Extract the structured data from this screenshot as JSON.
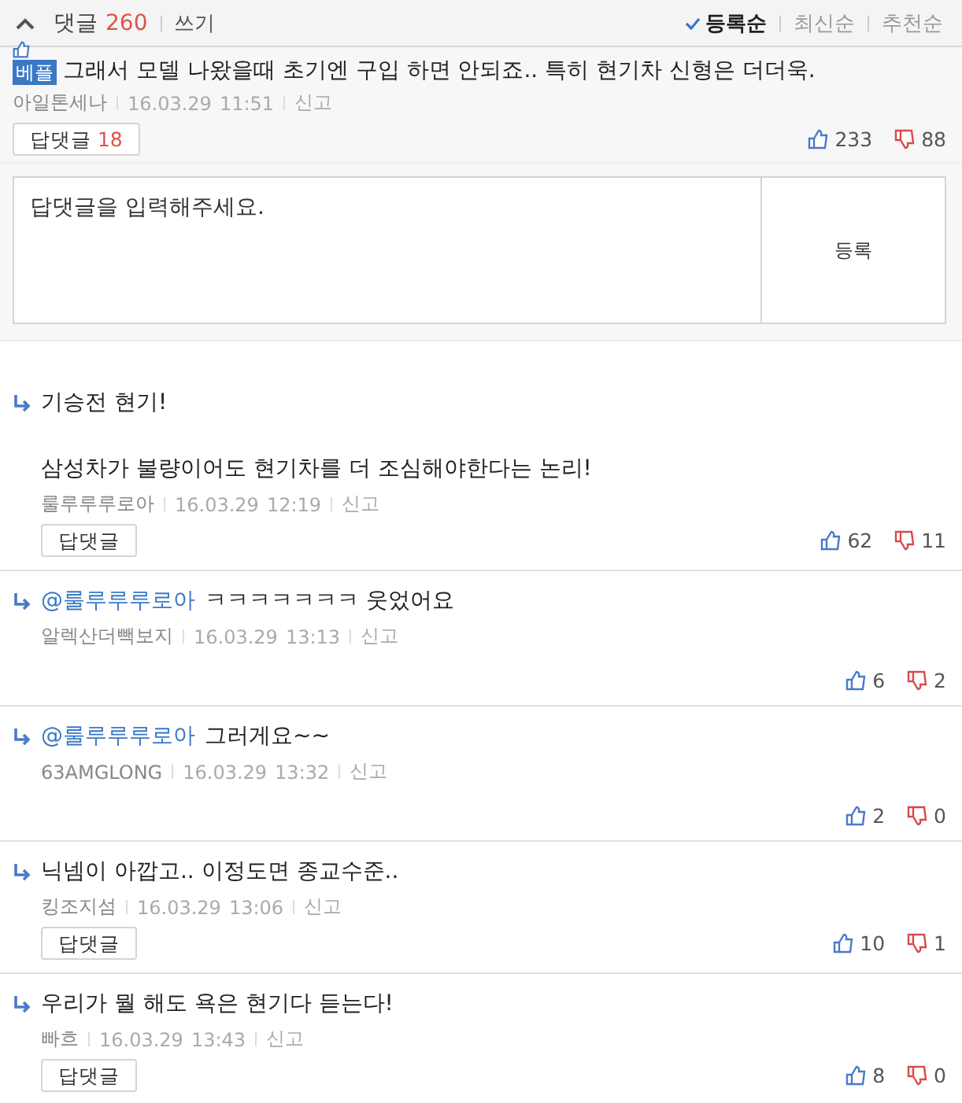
{
  "header": {
    "expanded": true,
    "title": "댓글",
    "count": "260",
    "write_link": "쓰기",
    "sort_options": [
      {
        "label": "등록순",
        "selected": true
      },
      {
        "label": "최신순",
        "selected": false
      },
      {
        "label": "추천순",
        "selected": false
      }
    ]
  },
  "best_comment": {
    "badge": "베플",
    "text": "그래서 모델 나왔을때 초기엔 구입 하면 안되죠.. 특히 현기차 신형은 더더욱.",
    "author": "아일톤세나",
    "date": "16.03.29",
    "time": "11:51",
    "report": "신고",
    "reply_button": {
      "label": "답댓글",
      "count": "18"
    },
    "likes": "233",
    "dislikes": "88"
  },
  "reply_form": {
    "placeholder": "답댓글을 입력해주세요.",
    "submit": "등록"
  },
  "replies": [
    {
      "lines": [
        "기승전 현기!",
        "삼성차가 불량이어도 현기차를 더 조심해야한다는 논리!"
      ],
      "author": "룰루루루로아",
      "date": "16.03.29",
      "time": "12:19",
      "report": "신고",
      "reply_button": "답댓글",
      "likes": "62",
      "dislikes": "11"
    },
    {
      "mention": "@룰루루루로아",
      "lines": [
        "ㅋㅋㅋㅋㅋㅋㅋ 웃었어요"
      ],
      "author": "알렉산더빽보지",
      "date": "16.03.29",
      "time": "13:13",
      "report": "신고",
      "likes": "6",
      "dislikes": "2"
    },
    {
      "mention": "@룰루루루로아",
      "lines": [
        "그러게요~~"
      ],
      "author": "63AMGLONG",
      "date": "16.03.29",
      "time": "13:32",
      "report": "신고",
      "likes": "2",
      "dislikes": "0"
    },
    {
      "lines": [
        "닉넴이 아깝고.. 이정도면 종교수준.."
      ],
      "author": "킹조지섬",
      "date": "16.03.29",
      "time": "13:06",
      "report": "신고",
      "reply_button": "답댓글",
      "likes": "10",
      "dislikes": "1"
    },
    {
      "lines": [
        "우리가 뭘 해도 욕은 현기다 듣는다!"
      ],
      "author": "빠흐",
      "date": "16.03.29",
      "time": "13:43",
      "report": "신고",
      "reply_button": "답댓글",
      "likes": "8",
      "dislikes": "0"
    }
  ]
}
